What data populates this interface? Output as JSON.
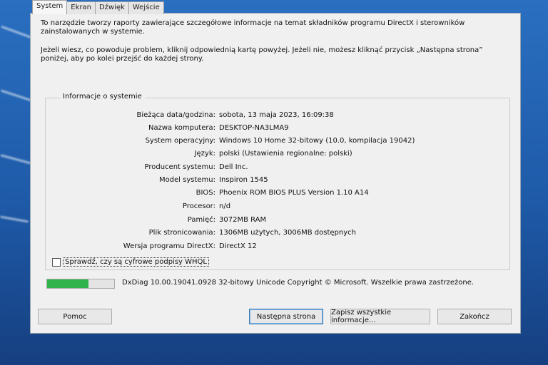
{
  "tabs": [
    "System",
    "Ekran",
    "Dźwięk",
    "Wejście"
  ],
  "intro": {
    "p1": "To narzędzie tworzy raporty zawierające szczegółowe informacje na temat składników programu DirectX i sterowników zainstalowanych w systemie.",
    "p2": "Jeżeli wiesz, co powoduje problem, kliknij odpowiednią kartę powyżej. Jeżeli nie, możesz kliknąć przycisk „Następna strona” poniżej, aby po kolei przejść do każdej strony."
  },
  "system_info": {
    "title": "Informacje o systemie",
    "rows": [
      {
        "label": "Bieżąca data/godzina:",
        "value": "sobota, 13 maja 2023, 16:09:38"
      },
      {
        "label": "Nazwa komputera:",
        "value": "DESKTOP-NA3LMA9"
      },
      {
        "label": "System operacyjny:",
        "value": "Windows 10 Home 32-bitowy (10.0, kompilacja 19042)"
      },
      {
        "label": "Język:",
        "value": "polski (Ustawienia regionalne: polski)"
      },
      {
        "label": "Producent systemu:",
        "value": "Dell Inc."
      },
      {
        "label": "Model systemu:",
        "value": "Inspiron 1545"
      },
      {
        "label": "BIOS:",
        "value": "Phoenix ROM BIOS PLUS Version 1.10 A14"
      },
      {
        "label": "Procesor:",
        "value": "n/d"
      },
      {
        "label": "Pamięć:",
        "value": "3072MB RAM"
      },
      {
        "label": "Plik stronicowania:",
        "value": "1306MB użytych, 3006MB dostępnych"
      },
      {
        "label": "Wersja programu DirectX:",
        "value": "DirectX 12"
      }
    ]
  },
  "whql_label": "Sprawdź, czy są cyfrowe podpisy WHQL",
  "progress": {
    "fraction": 0.62
  },
  "diag_text": "DxDiag 10.00.19041.0928 32-bitowy Unicode  Copyright © Microsoft. Wszelkie prawa zastrzeżone.",
  "buttons": {
    "help": "Pomoc",
    "next": "Następna strona",
    "save": "Zapisz wszystkie informacje...",
    "exit": "Zakończ"
  },
  "colors": {
    "progress_fill": "#2fb34a",
    "desktop_blue": "#1e5aa8"
  }
}
